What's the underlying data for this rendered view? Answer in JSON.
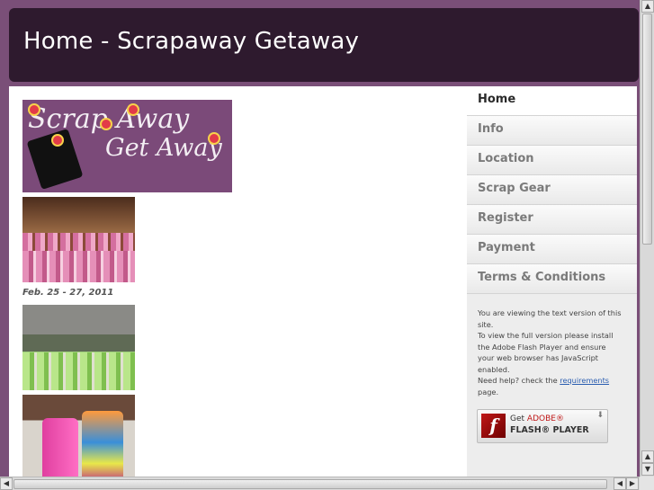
{
  "header": {
    "title": "Home - Scrapaway Getaway"
  },
  "logo": {
    "line1": "Scrap Away",
    "line2": "Get Away"
  },
  "main": {
    "date_caption": "Feb. 25 - 27, 2011"
  },
  "nav": {
    "items": [
      {
        "label": "Home",
        "active": true
      },
      {
        "label": "Info"
      },
      {
        "label": "Location"
      },
      {
        "label": "Scrap Gear"
      },
      {
        "label": "Register"
      },
      {
        "label": "Payment"
      },
      {
        "label": "Terms & Conditions"
      }
    ]
  },
  "notice": {
    "line1": "You are viewing the text version of this site.",
    "line2": "To view the full version please install the Adobe Flash Player and ensure your web browser has JavaScript enabled.",
    "line3_prefix": "Need help? check the",
    "link": "requirements",
    "line3_suffix": "page."
  },
  "flash_badge": {
    "get": "Get",
    "brand": "ADOBE®",
    "product": "FLASH® PLAYER",
    "logo_glyph": "f"
  },
  "scrollbar": {
    "up": "▲",
    "down": "▼",
    "left": "◀",
    "right": "▶"
  },
  "colors": {
    "page_bg": "#7a4f78",
    "header_bg": "#2e1a2e",
    "sidebar_bg": "#ededed",
    "flash_red": "#c01818"
  }
}
